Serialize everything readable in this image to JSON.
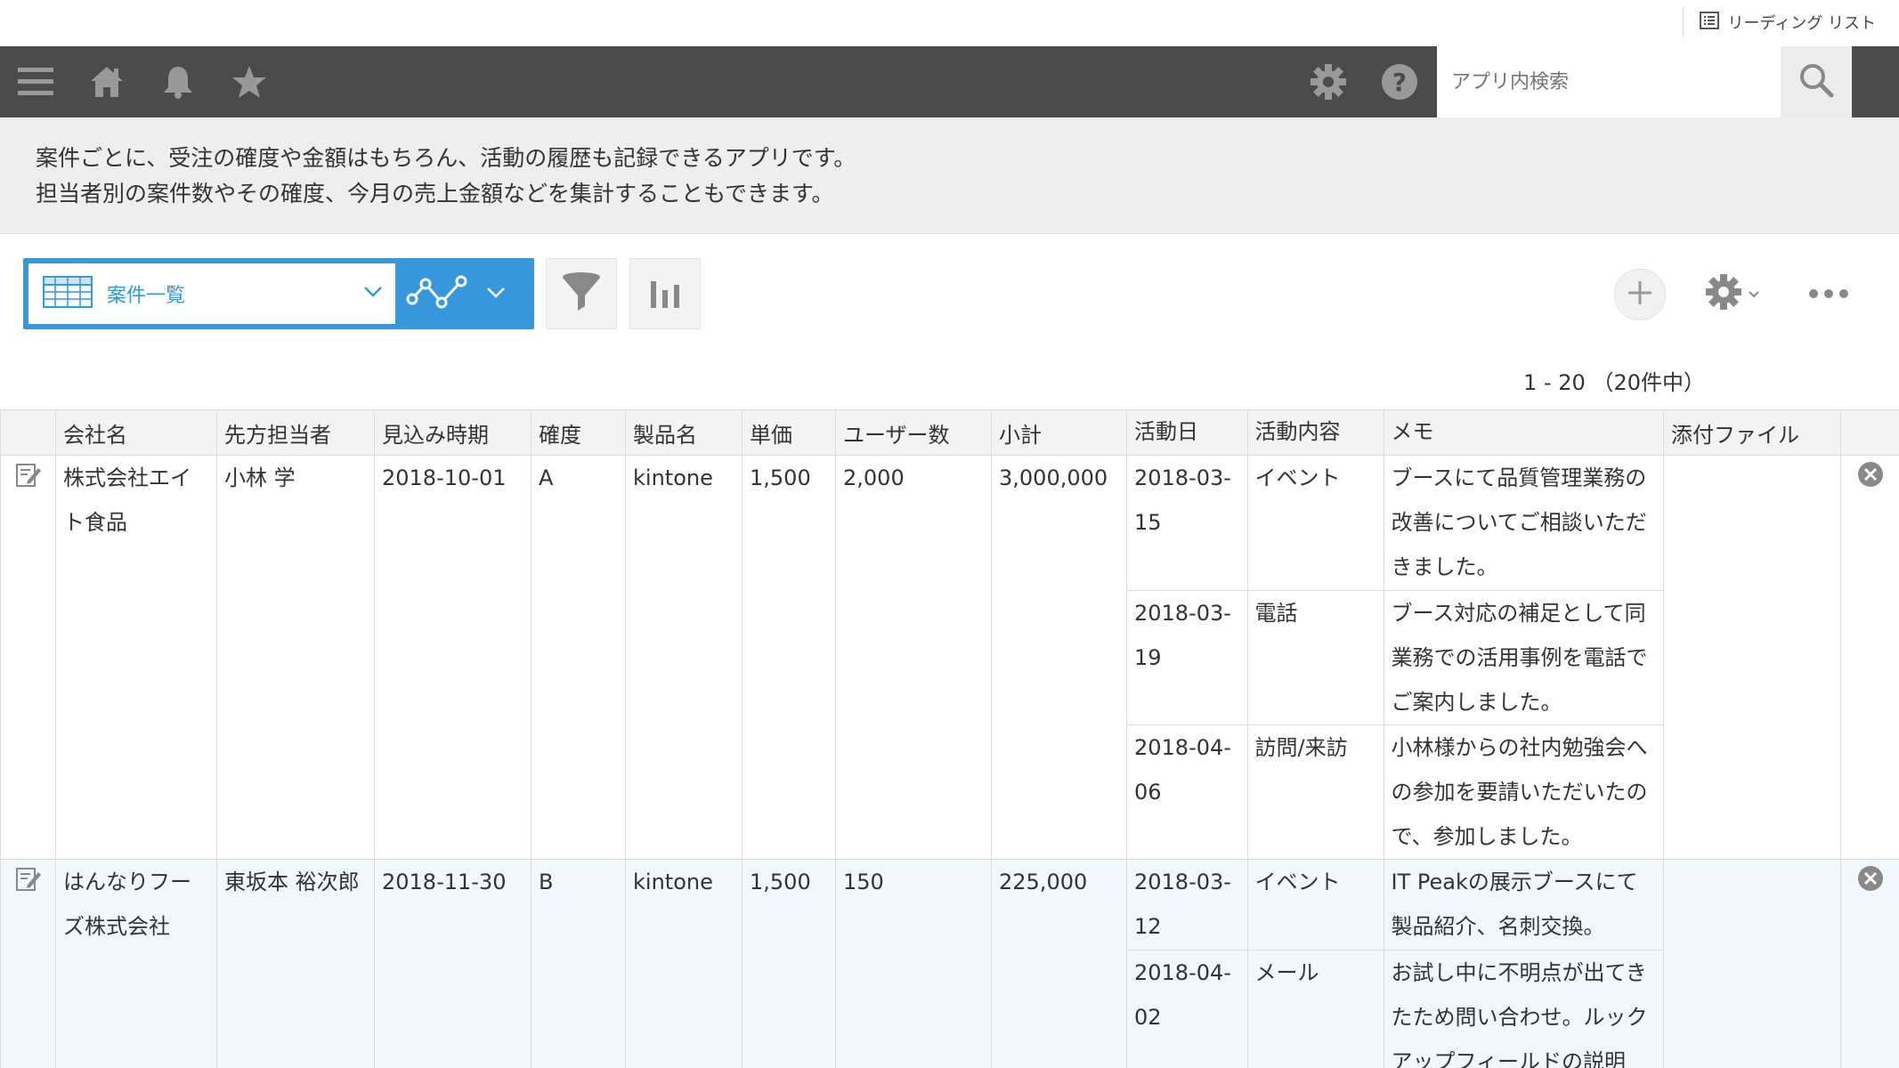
{
  "reading_list": {
    "label": "リーディング リスト"
  },
  "header": {
    "search_placeholder": "アプリ内検索",
    "icons": [
      "menu-icon",
      "home-icon",
      "bell-icon",
      "star-icon",
      "gear-icon",
      "help-icon",
      "search-icon"
    ]
  },
  "description": {
    "line1": "案件ごとに、受注の確度や金額はもちろん、活動の履歴も記録できるアプリです。",
    "line2": "担当者別の案件数やその確度、今月の売上金額などを集計することもできます。"
  },
  "toolbar": {
    "view_name": "案件一覧"
  },
  "pager": {
    "text": "1 - 20 （20件中）"
  },
  "table": {
    "headers": [
      "会社名",
      "先方担当者",
      "見込み時期",
      "確度",
      "製品名",
      "単価",
      "ユーザー数",
      "小計",
      "活動日",
      "活動内容",
      "メモ",
      "添付ファイル"
    ],
    "rows": [
      {
        "company": "株式会社エイト食品",
        "contact": "小林 学",
        "expected": "2018-10-01",
        "certainty": "A",
        "product": "kintone",
        "unit_price": "1,500",
        "users": "2,000",
        "subtotal": "3,000,000",
        "activities": [
          {
            "date": "2018-03-15",
            "type": "イベント",
            "memo": "ブースにて品質管理業務の改善についてご相談いただきました。"
          },
          {
            "date": "2018-03-19",
            "type": "電話",
            "memo": "ブース対応の補足として同業務での活用事例を電話でご案内しました。"
          },
          {
            "date": "2018-04-06",
            "type": "訪問/来訪",
            "memo": "小林様からの社内勉強会への参加を要請いただいたので、参加しました。"
          }
        ]
      },
      {
        "company": "はんなりフーズ株式会社",
        "contact": "東坂本 裕次郎",
        "expected": "2018-11-30",
        "certainty": "B",
        "product": "kintone",
        "unit_price": "1,500",
        "users": "150",
        "subtotal": "225,000",
        "activities": [
          {
            "date": "2018-03-12",
            "type": "イベント",
            "memo": "IT Peakの展示ブースにて製品紹介、名刺交換。"
          },
          {
            "date": "2018-04-02",
            "type": "メール",
            "memo": "お試し中に不明点が出てきたため問い合わせ。ルックアップフィールドの説明"
          }
        ]
      }
    ]
  }
}
